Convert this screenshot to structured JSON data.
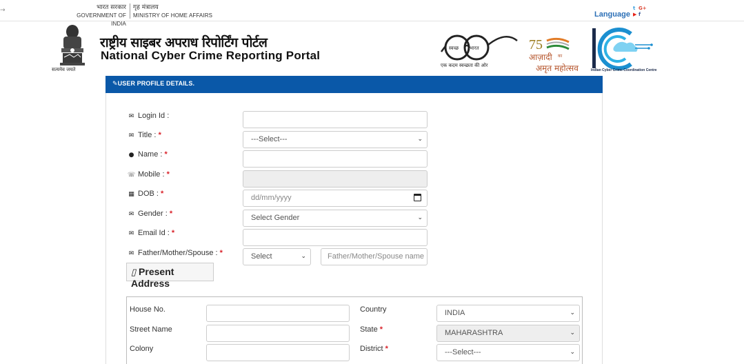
{
  "topbar": {
    "gov_hi": "भारत सरकार",
    "gov_en": "GOVERNMENT OF INDIA",
    "ministry_hi": "गृह मंत्रालय",
    "ministry_en": "MINISTRY OF HOME AFFAIRS",
    "language": "Language",
    "arrow": "→"
  },
  "header": {
    "title_hi": "राष्ट्रीय साइबर अपराध रिपोर्टिंग पोर्टल",
    "title_en": "National Cyber Crime Reporting Portal",
    "emblem_caption": "सत्यमेव जयते",
    "swachh_left": "स्वच्छ",
    "swachh_right": "भारत",
    "swachh_caption": "एक कदम स्वच्छता की ओर",
    "azadi_num": "75",
    "azadi_text1": "आज़ादी",
    "azadi_ka": "का",
    "azadi_text2": "अमृत महोत्सव",
    "i4c_caption": "Indian Cyber Crime Coordination Centre"
  },
  "panel": {
    "title": "USER PROFILE DETAILS."
  },
  "form": {
    "login_label": "Login Id :",
    "title_label": "Title :",
    "name_label": "Name :",
    "mobile_label": "Mobile :",
    "dob_label": "DOB :",
    "gender_label": "Gender :",
    "email_label": "Email Id :",
    "relation_label": "Father/Mother/Spouse :",
    "required_mark": "*",
    "title_value": "---Select---",
    "dob_placeholder": "dd/mm/yyyy",
    "gender_value": "Select Gender",
    "relation_select_value": "Select",
    "relation_name_placeholder": "Father/Mother/Spouse name"
  },
  "present_address": {
    "button_label": "Present Address",
    "house_label": "House No.",
    "street_label": "Street Name",
    "colony_label": "Colony",
    "country_label": "Country",
    "state_label": "State",
    "district_label": "District",
    "country_value": "INDIA",
    "state_value": "MAHARASHTRA",
    "district_value": "---Select---"
  }
}
